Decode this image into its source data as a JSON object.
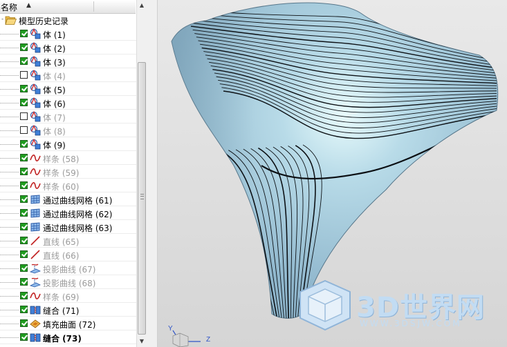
{
  "navigator": {
    "column_header": "名称",
    "root": {
      "label": "模型历史记录",
      "icon": "open-folder-icon"
    },
    "items": [
      {
        "label": "体 (1)",
        "checked": true,
        "active": true,
        "icon": "body-feature-icon"
      },
      {
        "label": "体 (2)",
        "checked": true,
        "active": true,
        "icon": "body-feature-icon"
      },
      {
        "label": "体 (3)",
        "checked": true,
        "active": true,
        "icon": "body-feature-icon"
      },
      {
        "label": "体 (4)",
        "checked": false,
        "active": false,
        "icon": "body-feature-icon"
      },
      {
        "label": "体 (5)",
        "checked": true,
        "active": true,
        "icon": "body-feature-icon"
      },
      {
        "label": "体 (6)",
        "checked": true,
        "active": true,
        "icon": "body-feature-icon"
      },
      {
        "label": "体 (7)",
        "checked": false,
        "active": false,
        "icon": "body-feature-icon"
      },
      {
        "label": "体 (8)",
        "checked": false,
        "active": false,
        "icon": "body-feature-icon"
      },
      {
        "label": "体 (9)",
        "checked": true,
        "active": true,
        "icon": "body-feature-icon"
      },
      {
        "label": "样条 (58)",
        "checked": true,
        "active": false,
        "icon": "spline-icon"
      },
      {
        "label": "样条 (59)",
        "checked": true,
        "active": false,
        "icon": "spline-icon"
      },
      {
        "label": "样条 (60)",
        "checked": true,
        "active": false,
        "icon": "spline-icon"
      },
      {
        "label": "通过曲线网格 (61)",
        "checked": true,
        "active": true,
        "icon": "curve-mesh-icon"
      },
      {
        "label": "通过曲线网格 (62)",
        "checked": true,
        "active": true,
        "icon": "curve-mesh-icon"
      },
      {
        "label": "通过曲线网格 (63)",
        "checked": true,
        "active": true,
        "icon": "curve-mesh-icon"
      },
      {
        "label": "直线 (65)",
        "checked": true,
        "active": false,
        "icon": "line-icon"
      },
      {
        "label": "直线 (66)",
        "checked": true,
        "active": false,
        "icon": "line-icon"
      },
      {
        "label": "投影曲线 (67)",
        "checked": true,
        "active": false,
        "icon": "projected-curve-icon"
      },
      {
        "label": "投影曲线 (68)",
        "checked": true,
        "active": false,
        "icon": "projected-curve-icon"
      },
      {
        "label": "样条 (69)",
        "checked": true,
        "active": false,
        "icon": "spline-icon"
      },
      {
        "label": "缝合 (71)",
        "checked": true,
        "active": true,
        "icon": "sew-icon"
      },
      {
        "label": "填充曲面 (72)",
        "checked": true,
        "active": true,
        "icon": "fill-surface-icon"
      },
      {
        "label": "缝合 (73)",
        "checked": true,
        "active": true,
        "current": true,
        "icon": "sew-icon"
      }
    ]
  },
  "viewport": {
    "surface_color": "#8fb6cc",
    "highlight_color": "#e9fbfc",
    "isoline_color": "#0c1014"
  },
  "watermark": {
    "brand": "3D世界网",
    "url": "WWW.3DSJW.COM"
  },
  "triad": {
    "labels": [
      "Y",
      "Z"
    ]
  }
}
